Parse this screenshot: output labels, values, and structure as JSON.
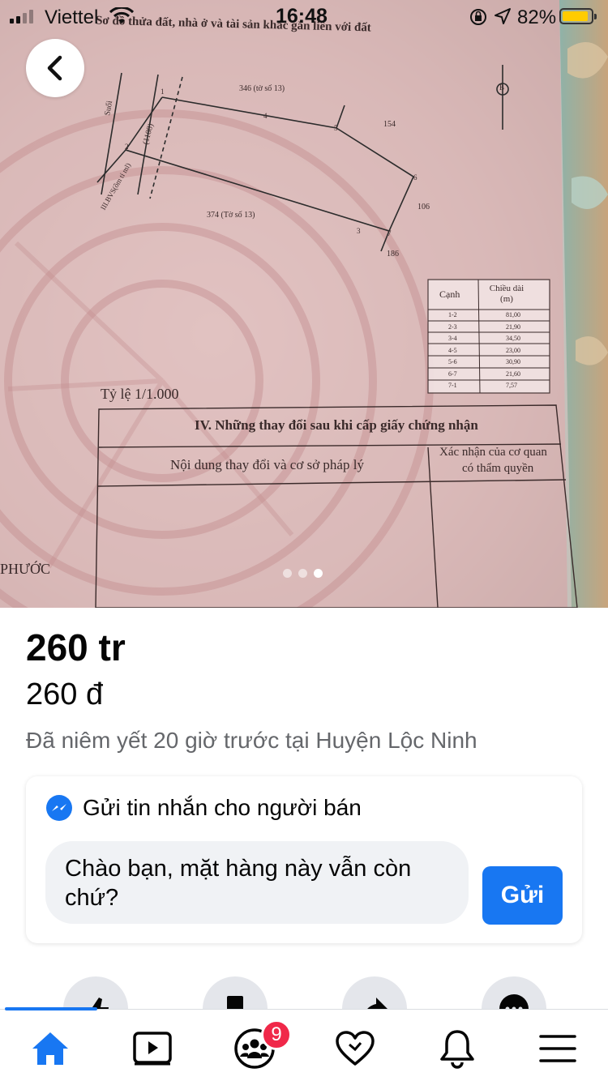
{
  "status_bar": {
    "carrier": "Viettel",
    "time": "16:48",
    "battery": "82%"
  },
  "photo": {
    "doc_header": "Sơ đồ thửa đất, nhà ở và tài sản khác gắn liền với đất",
    "map_labels": [
      "346 (tờ số 13)",
      "154",
      "106",
      "374 (Tờ số 13)",
      "186",
      "(1108)",
      "III.BVS(ôm tỉ ml)",
      "Suối",
      "B"
    ],
    "vertex_labels": [
      "1",
      "2",
      "3",
      "4",
      "5",
      "6",
      "7"
    ],
    "table_header_canh": "Cạnh",
    "table_header_length": "Chiều dài (m)",
    "table_rows": [
      {
        "edge": "1-2",
        "length": "81,00"
      },
      {
        "edge": "2-3",
        "length": "21,90"
      },
      {
        "edge": "3-4",
        "length": "34,50"
      },
      {
        "edge": "4-5",
        "length": "23,00"
      },
      {
        "edge": "5-6",
        "length": "30,90"
      },
      {
        "edge": "6-7",
        "length": "21,60"
      },
      {
        "edge": "7-1",
        "length": "7,57"
      }
    ],
    "scale": "Tỷ lệ 1/1.000",
    "section_title": "IV. Những thay đổi sau khi cấp giấy chứng nhận",
    "col_left": "Nội dung thay đổi và cơ sở pháp lý",
    "col_right_1": "Xác nhận của cơ quan",
    "col_right_2": "có thẩm quyền",
    "bottom_left": "PHƯỚC"
  },
  "carousel": {
    "count": 3,
    "active_index": 2
  },
  "listing": {
    "price_main": "260 tr",
    "price_sub": "260 đ",
    "listed_text": "Đã niêm yết 20 giờ trước tại Huyện Lộc Ninh"
  },
  "message_card": {
    "header": "Gửi tin nhắn cho người bán",
    "input_text": "Chào bạn, mặt hàng này vẫn còn chứ?",
    "send_label": "Gửi"
  },
  "tab_bar": {
    "groups_badge": "9"
  },
  "colors": {
    "accent": "#1877f2",
    "badge": "#f02849",
    "muted_text": "#65676b"
  }
}
